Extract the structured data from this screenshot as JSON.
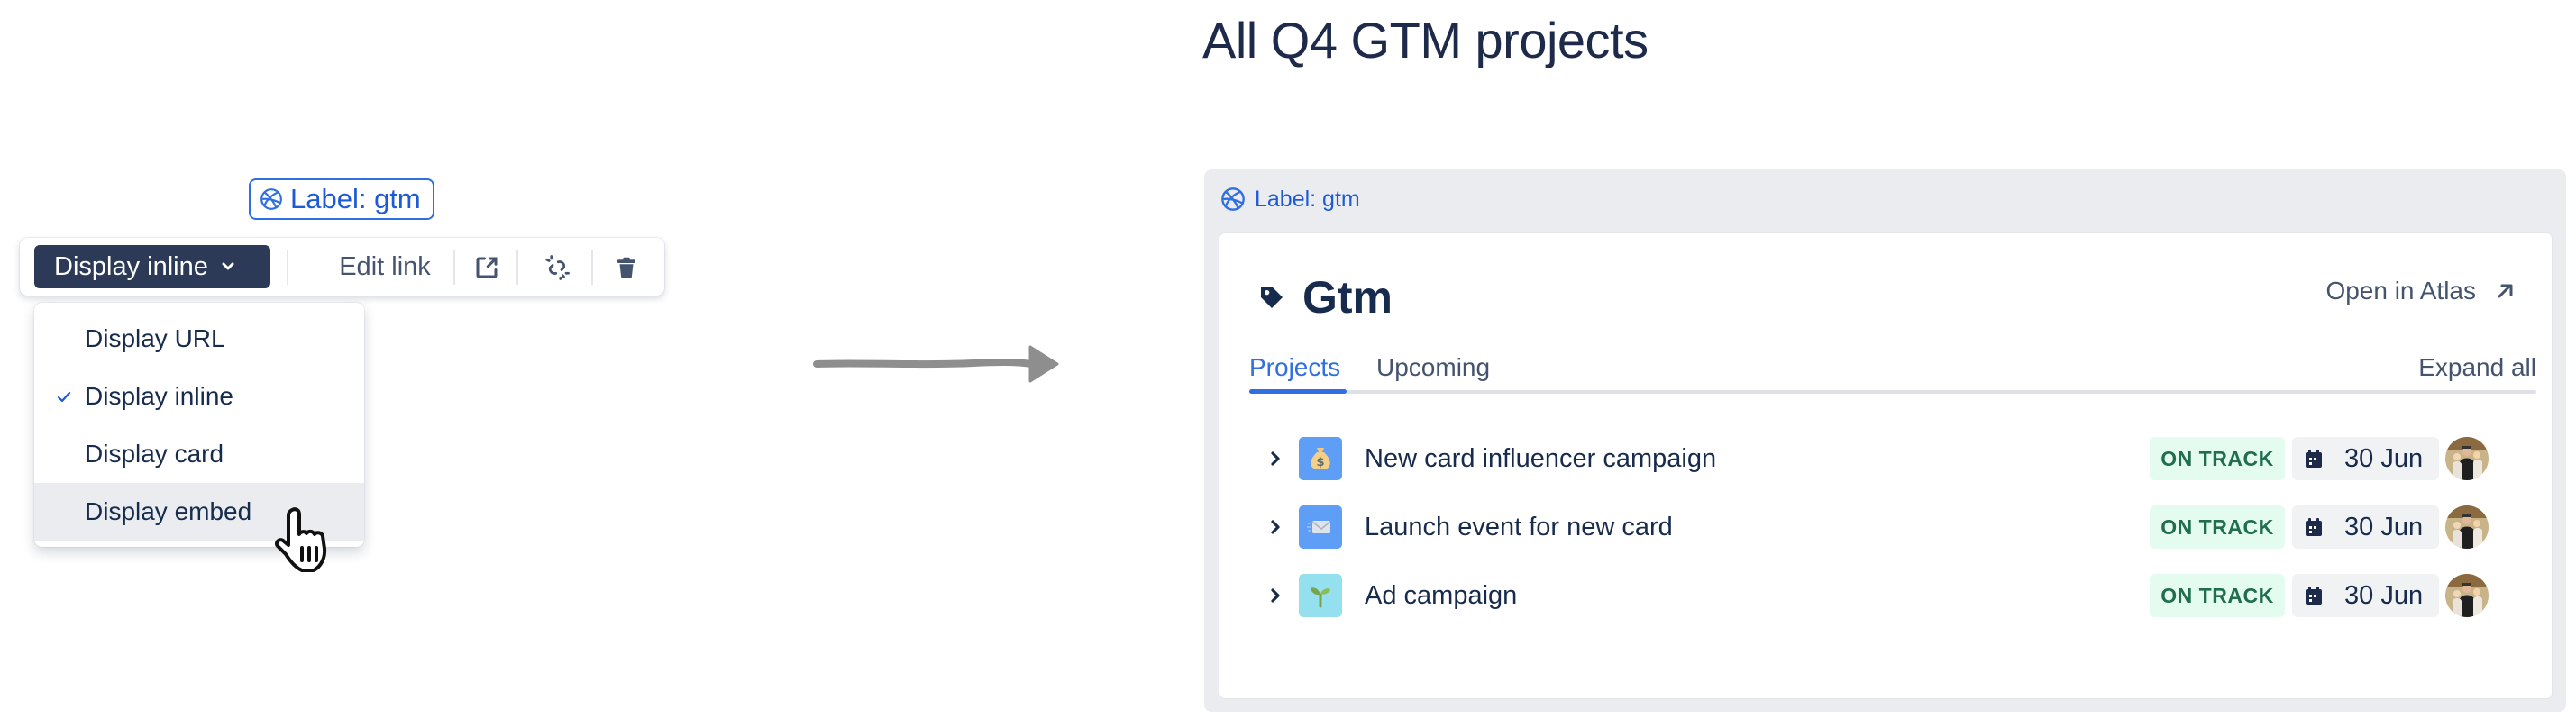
{
  "inline_link": {
    "label": "Label: gtm",
    "link_color": "#1d5bd6"
  },
  "toolbar": {
    "display_button_label": "Display inline",
    "edit_link_label": "Edit link",
    "icons": [
      "open-in-new-window-icon",
      "unlink-icon",
      "trash-icon"
    ]
  },
  "dropdown": {
    "items": [
      {
        "label": "Display URL",
        "selected": false,
        "hovered": false
      },
      {
        "label": "Display inline",
        "selected": true,
        "hovered": false
      },
      {
        "label": "Display card",
        "selected": false,
        "hovered": false
      },
      {
        "label": "Display embed",
        "selected": false,
        "hovered": true
      }
    ]
  },
  "embed": {
    "page_title": "All Q4 GTM projects",
    "frame_label": "Label: gtm",
    "card_title": "Gtm",
    "open_link": "Open in Atlas",
    "tabs": [
      {
        "label": "Projects",
        "active": true
      },
      {
        "label": "Upcoming",
        "active": false
      }
    ],
    "expand_all": "Expand all",
    "projects": [
      {
        "name": "New card influencer campaign",
        "icon": "money-bag-icon",
        "icon_bg": "#5e9ef7",
        "status": "ON TRACK",
        "due": "30 Jun"
      },
      {
        "name": "Launch event for new card",
        "icon": "envelope-icon",
        "icon_bg": "#5e9ef7",
        "status": "ON TRACK",
        "due": "30 Jun"
      },
      {
        "name": "Ad campaign",
        "icon": "seedling-icon",
        "icon_bg": "#94e0ef",
        "status": "ON TRACK",
        "due": "30 Jun"
      }
    ]
  }
}
